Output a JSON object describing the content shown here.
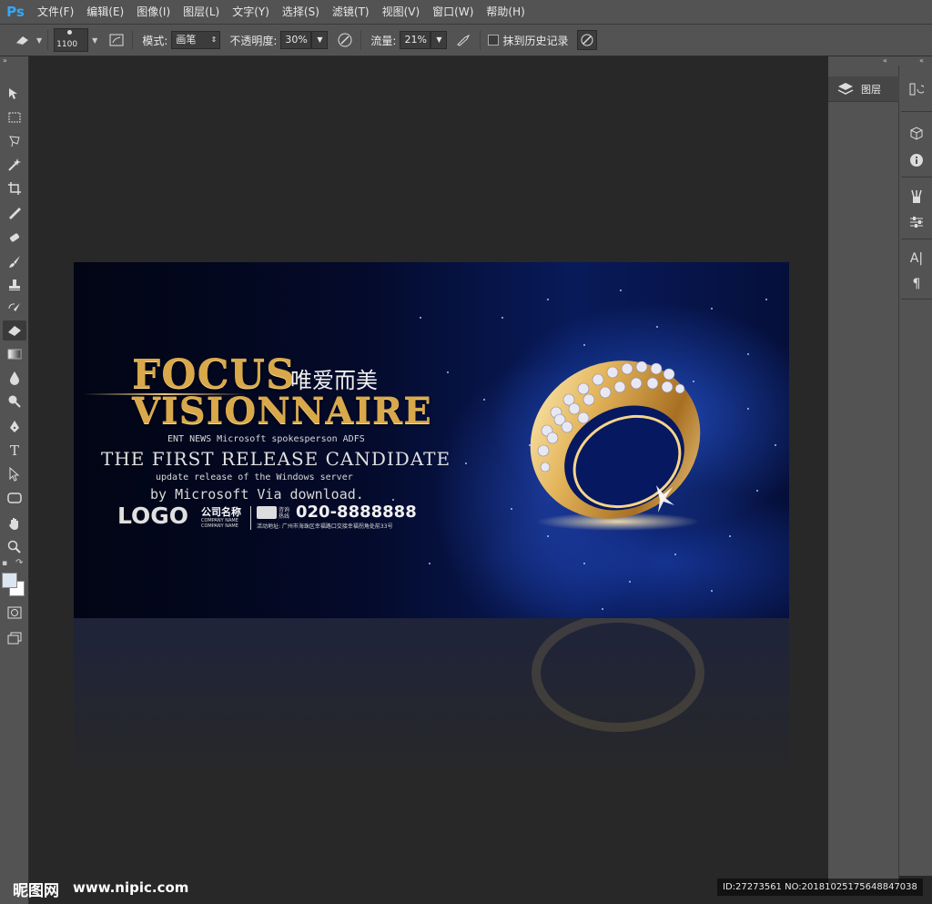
{
  "app": {
    "logo": "Ps"
  },
  "menu": [
    "文件(F)",
    "编辑(E)",
    "图像(I)",
    "图层(L)",
    "文字(Y)",
    "选择(S)",
    "滤镜(T)",
    "视图(V)",
    "窗口(W)",
    "帮助(H)"
  ],
  "options": {
    "brush_size": "1100",
    "mode_label": "模式:",
    "mode_value": "画笔",
    "opacity_label": "不透明度:",
    "opacity_value": "30%",
    "flow_label": "流量:",
    "flow_value": "21%",
    "history_label": "抹到历史记录"
  },
  "panels": {
    "layers_tab": "图层"
  },
  "banner": {
    "title1": "FOCUS",
    "title_cn": "唯爱而美",
    "title2": "VISIONNAIRE",
    "line1": "ENT NEWS Microsoft spokesperson ADFS",
    "line2": "THE FIRST RELEASE CANDIDATE",
    "line3": "update release of the Windows server",
    "line4": "by Microsoft Via download.",
    "logo": "LOGO",
    "company_cn": "公司名称",
    "company_en1": "COMPANY NAME",
    "company_en2": "COMPANY NAME",
    "hotline_label1": "咨询",
    "hotline_label2": "热线",
    "phone": "020-8888888",
    "address": "活动地址: 广州市海珠区幸福路口交接幸福拐角处前33号"
  },
  "watermark": {
    "site_cn": "昵图网",
    "site_url": "www.nipic.com",
    "id_text": "ID:27273561 NO:20181025175648847038"
  },
  "colors": {
    "accent_gold": "#d8a84a",
    "chrome": "#535353",
    "workspace": "#282828"
  }
}
